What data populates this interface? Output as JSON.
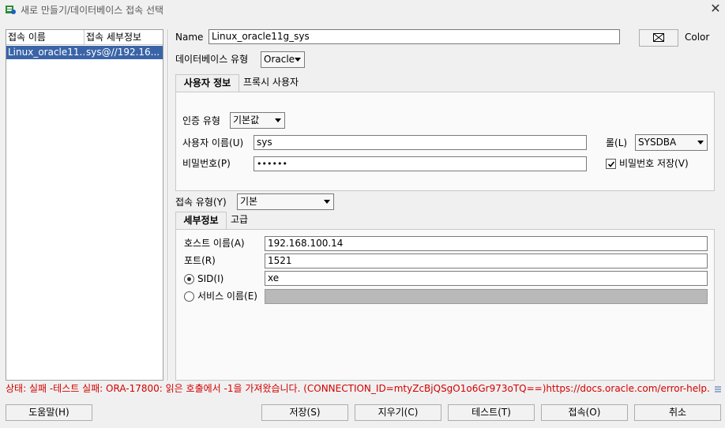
{
  "window": {
    "title": "새로 만들기/데이터베이스 접속 선택"
  },
  "connections": {
    "columns": [
      "접속 이름",
      "접속 세부정보"
    ],
    "rows": [
      {
        "name": "Linux_oracle11...",
        "details": "sys@//192.16..."
      }
    ]
  },
  "form": {
    "name_label": "Name",
    "name_value": "Linux_oracle11g_sys",
    "color_label": "Color",
    "db_type_label": "데이터베이스 유형",
    "db_type_value": "Oracle",
    "tabs": [
      "사용자 정보",
      "프록시 사용자"
    ],
    "auth_type_label": "인증 유형",
    "auth_type_value": "기본값",
    "username_label": "사용자 이름(U)",
    "username_value": "sys",
    "role_label": "롤(L)",
    "role_value": "SYSDBA",
    "password_label": "비밀번호(P)",
    "password_value": "••••••",
    "save_password_label": "비밀번호 저장(V)",
    "conn_type_label": "접속 유형(Y)",
    "conn_type_value": "기본",
    "detail_tabs": [
      "세부정보",
      "고급"
    ],
    "host_label": "호스트 이름(A)",
    "host_value": "192.168.100.14",
    "port_label": "포트(R)",
    "port_value": "1521",
    "sid_label": "SID(I)",
    "sid_value": "xe",
    "service_label": "서비스 이름(E)"
  },
  "status": "상태: 실패 -테스트 실패: ORA-17800: 읽은 호출에서 -1을 가져왔습니다. (CONNECTION_ID=mtyZcBjQSgO1o6Gr973oTQ==)https://docs.oracle.com/error-help...",
  "buttons": {
    "help": "도움말(H)",
    "save": "저장(S)",
    "clear": "지우기(C)",
    "test": "테스트(T)",
    "connect": "접속(O)",
    "cancel": "취소"
  }
}
